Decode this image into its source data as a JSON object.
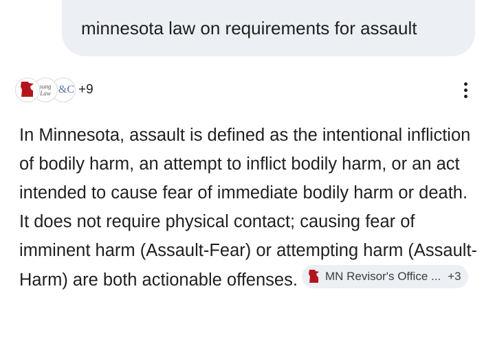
{
  "query": {
    "text": "minnesota law on requirements for assault"
  },
  "sources": {
    "icons": [
      "minnesota-shape-icon",
      "law-firm-logo-icon",
      "sc-logo-icon"
    ],
    "logo_line1": "sung",
    "logo_line2": "Law",
    "logo_sc": "S&C",
    "more_count": "+9"
  },
  "answer": {
    "text": "In Minnesota, assault is defined as the intentional infliction of bodily harm, an attempt to inflict bodily harm, or an act intended to cause fear of immediate bodily harm or death. It does not require physical contact; causing fear of imminent harm (Assault-Fear) or attempting harm (Assault-Harm) are both actionable offenses.",
    "citation": {
      "label": "MN Revisor's Office ...",
      "count": "+3",
      "icon": "minnesota-shape-icon",
      "icon_color": "#b3141b"
    }
  },
  "colors": {
    "bubble": "#eceff3",
    "text": "#1f1f1f",
    "accent_red": "#b3141b"
  }
}
